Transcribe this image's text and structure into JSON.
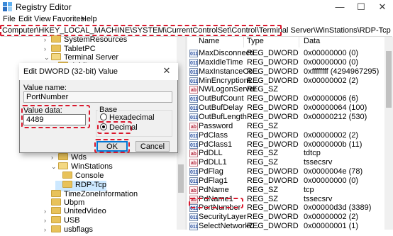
{
  "window": {
    "title": "Registry Editor",
    "minimize": "—",
    "maximize": "☐",
    "close": "✕"
  },
  "menu": [
    "File",
    "Edit",
    "View",
    "Favorites",
    "Help"
  ],
  "address": "Computer\\HKEY_LOCAL_MACHINE\\SYSTEM\\CurrentControlSet\\Control\\Terminal Server\\WinStations\\RDP-Tcp",
  "tree": [
    {
      "label": "SystemResources",
      "exp": "›",
      "level": 1
    },
    {
      "label": "TabletPC",
      "exp": "›",
      "level": 1
    },
    {
      "label": "Terminal Server",
      "exp": "⌄",
      "level": 1,
      "open": true
    },
    {
      "label": "AddIns",
      "exp": "›",
      "level": 2
    },
    {
      "label": "Wds",
      "exp": "›",
      "level": 2
    },
    {
      "label": "WinStations",
      "exp": "⌄",
      "level": 2,
      "open": true
    },
    {
      "label": "Console",
      "exp": "",
      "level": 3
    },
    {
      "label": "RDP-Tcp",
      "exp": "",
      "level": 3,
      "selected": true
    },
    {
      "label": "TimeZoneInformation",
      "exp": "",
      "level": 1
    },
    {
      "label": "Ubpm",
      "exp": "",
      "level": 1
    },
    {
      "label": "UnitedVideo",
      "exp": "›",
      "level": 1
    },
    {
      "label": "USB",
      "exp": "›",
      "level": 1
    },
    {
      "label": "usbflags",
      "exp": "›",
      "level": 1
    }
  ],
  "list": {
    "columns": [
      "Name",
      "Type",
      "Data"
    ],
    "rows": [
      {
        "name": "MaxDisconnecti...",
        "type": "REG_DWORD",
        "data": "0x00000000 (0)",
        "icon": "dw"
      },
      {
        "name": "MaxIdleTime",
        "type": "REG_DWORD",
        "data": "0x00000000 (0)",
        "icon": "dw"
      },
      {
        "name": "MaxInstanceCo...",
        "type": "REG_DWORD",
        "data": "0xffffffff (4294967295)",
        "icon": "dw"
      },
      {
        "name": "MinEncryptionL...",
        "type": "REG_DWORD",
        "data": "0x00000002 (2)",
        "icon": "dw"
      },
      {
        "name": "NWLogonServer",
        "type": "REG_SZ",
        "data": "",
        "icon": "sz"
      },
      {
        "name": "OutBufCount",
        "type": "REG_DWORD",
        "data": "0x00000006 (6)",
        "icon": "dw"
      },
      {
        "name": "OutBufDelay",
        "type": "REG_DWORD",
        "data": "0x00000064 (100)",
        "icon": "dw"
      },
      {
        "name": "OutBufLength",
        "type": "REG_DWORD",
        "data": "0x00000212 (530)",
        "icon": "dw"
      },
      {
        "name": "Password",
        "type": "REG_SZ",
        "data": "",
        "icon": "sz"
      },
      {
        "name": "PdClass",
        "type": "REG_DWORD",
        "data": "0x00000002 (2)",
        "icon": "dw"
      },
      {
        "name": "PdClass1",
        "type": "REG_DWORD",
        "data": "0x0000000b (11)",
        "icon": "dw"
      },
      {
        "name": "PdDLL",
        "type": "REG_SZ",
        "data": "tdtcp",
        "icon": "sz"
      },
      {
        "name": "PdDLL1",
        "type": "REG_SZ",
        "data": "tssecsrv",
        "icon": "sz"
      },
      {
        "name": "PdFlag",
        "type": "REG_DWORD",
        "data": "0x0000004e (78)",
        "icon": "dw"
      },
      {
        "name": "PdFlag1",
        "type": "REG_DWORD",
        "data": "0x00000000 (0)",
        "icon": "dw"
      },
      {
        "name": "PdName",
        "type": "REG_SZ",
        "data": "tcp",
        "icon": "sz"
      },
      {
        "name": "PdName1",
        "type": "REG_SZ",
        "data": "tssecsrv",
        "icon": "sz"
      },
      {
        "name": "PortNumber",
        "type": "REG_DWORD",
        "data": "0x00000d3d (3389)",
        "icon": "dw"
      },
      {
        "name": "SecurityLayer",
        "type": "REG_DWORD",
        "data": "0x00000002 (2)",
        "icon": "dw"
      },
      {
        "name": "SelectNetworkD...",
        "type": "REG_DWORD",
        "data": "0x00000001 (1)",
        "icon": "dw"
      }
    ]
  },
  "dialog": {
    "title": "Edit DWORD (32-bit) Value",
    "close": "✕",
    "value_name_label": "Value name:",
    "value_name": "PortNumber",
    "value_data_label": "Value data:",
    "value_data": "4489",
    "base_label": "Base",
    "hex_label": "Hexadecimal",
    "dec_label": "Decimal",
    "ok": "OK",
    "cancel": "Cancel"
  },
  "colors": {
    "highlight": "#d9182d",
    "selection": "#cce8ff"
  }
}
